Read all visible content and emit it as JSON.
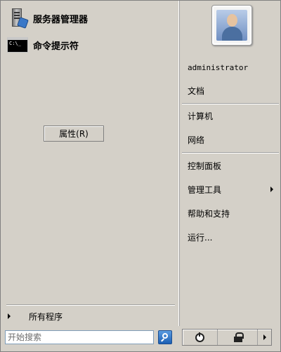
{
  "pinned": [
    {
      "label": "服务器管理器",
      "icon": "server-manager-icon"
    },
    {
      "label": "命令提示符",
      "icon": "command-prompt-icon",
      "screen_text": "C:\\_"
    }
  ],
  "properties_button": "属性(R)",
  "all_programs": "所有程序",
  "user": {
    "name": "administrator",
    "avatar": "user-avatar-icon"
  },
  "right_items": {
    "documents": "文档",
    "computer": "计算机",
    "network": "网络",
    "control_panel": "控制面板",
    "admin_tools": "管理工具",
    "help": "帮助和支持",
    "run": "运行..."
  },
  "search": {
    "placeholder": "开始搜索"
  }
}
